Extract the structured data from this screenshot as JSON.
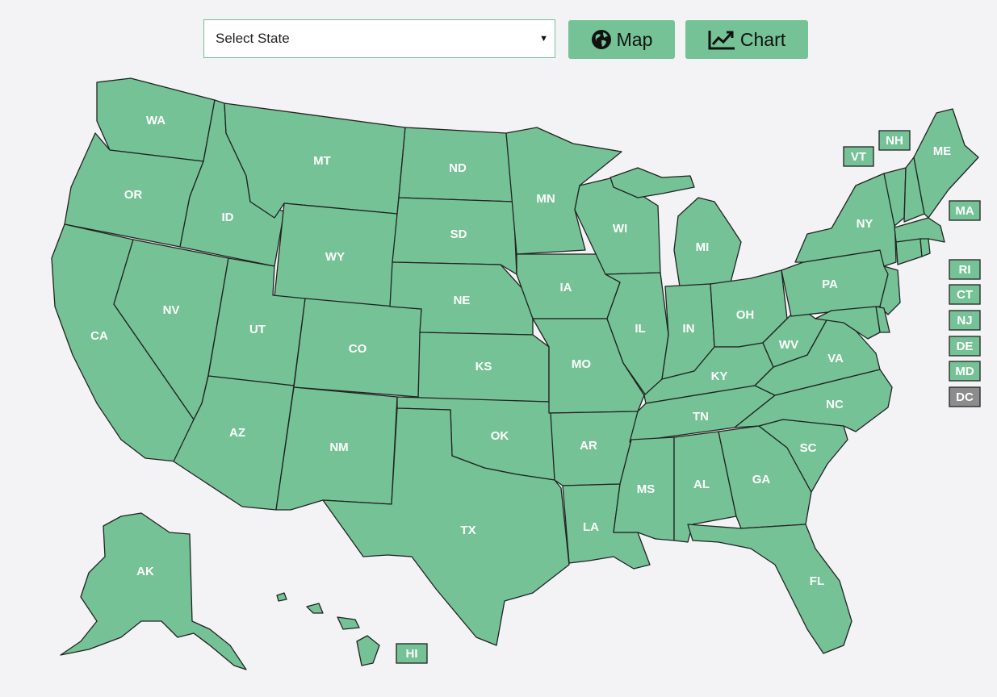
{
  "toolbar": {
    "select_placeholder": "Select State",
    "map_button_label": "Map",
    "chart_button_label": "Chart",
    "map_icon": "globe-icon",
    "chart_icon": "line-chart-icon"
  },
  "colors": {
    "background": "#f3f3f5",
    "state_fill": "#74c295",
    "state_stroke": "#222222",
    "label_text": "#ffffff",
    "dc_fill": "#8c8c8c"
  },
  "states": {
    "WA": "WA",
    "OR": "OR",
    "CA": "CA",
    "ID": "ID",
    "NV": "NV",
    "MT": "MT",
    "WY": "WY",
    "UT": "UT",
    "AZ": "AZ",
    "CO": "CO",
    "NM": "NM",
    "ND": "ND",
    "SD": "SD",
    "NE": "NE",
    "KS": "KS",
    "OK": "OK",
    "TX": "TX",
    "MN": "MN",
    "IA": "IA",
    "MO": "MO",
    "AR": "AR",
    "LA": "LA",
    "WI": "WI",
    "IL": "IL",
    "MI": "MI",
    "IN": "IN",
    "OH": "OH",
    "KY": "KY",
    "TN": "TN",
    "MS": "MS",
    "AL": "AL",
    "GA": "GA",
    "FL": "FL",
    "SC": "SC",
    "NC": "NC",
    "VA": "VA",
    "WV": "WV",
    "PA": "PA",
    "NY": "NY",
    "ME": "ME",
    "AK": "AK",
    "HI": "HI"
  },
  "small_states": {
    "VT": "VT",
    "NH": "NH",
    "MA": "MA",
    "RI": "RI",
    "CT": "CT",
    "NJ": "NJ",
    "DE": "DE",
    "MD": "MD",
    "DC": "DC"
  }
}
